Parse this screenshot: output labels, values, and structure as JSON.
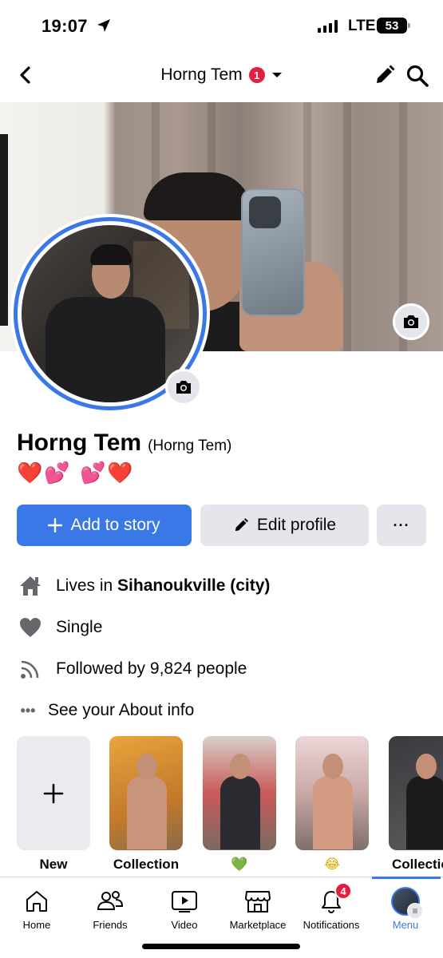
{
  "status_bar": {
    "time": "19:07",
    "network": "LTE",
    "battery": "53"
  },
  "header": {
    "title": "Horng Tem",
    "badge_count": "1"
  },
  "profile": {
    "name": "Horng Tem",
    "alt_name": "(Horng Tem)",
    "bio_emojis": "❤️💕 💕❤️"
  },
  "actions": {
    "add_story": "Add to story",
    "edit_profile": "Edit profile",
    "more": "···"
  },
  "info": {
    "lives_prefix": "Lives in",
    "lives_city": "Sihanoukville (city)",
    "relationship": "Single",
    "followers": "Followed by 9,824 people",
    "about": "See your About info"
  },
  "highlights": [
    {
      "label": "New"
    },
    {
      "label": "Collection"
    },
    {
      "label": "💚"
    },
    {
      "label": "😂"
    },
    {
      "label": "Collection"
    }
  ],
  "nav": {
    "items": [
      {
        "label": "Home"
      },
      {
        "label": "Friends"
      },
      {
        "label": "Video"
      },
      {
        "label": "Marketplace"
      },
      {
        "label": "Notifications",
        "badge": "4"
      },
      {
        "label": "Menu"
      }
    ]
  },
  "colors": {
    "accent": "#3b78e7",
    "badge": "#e41e3f",
    "secondary_button": "#e4e6eb"
  }
}
